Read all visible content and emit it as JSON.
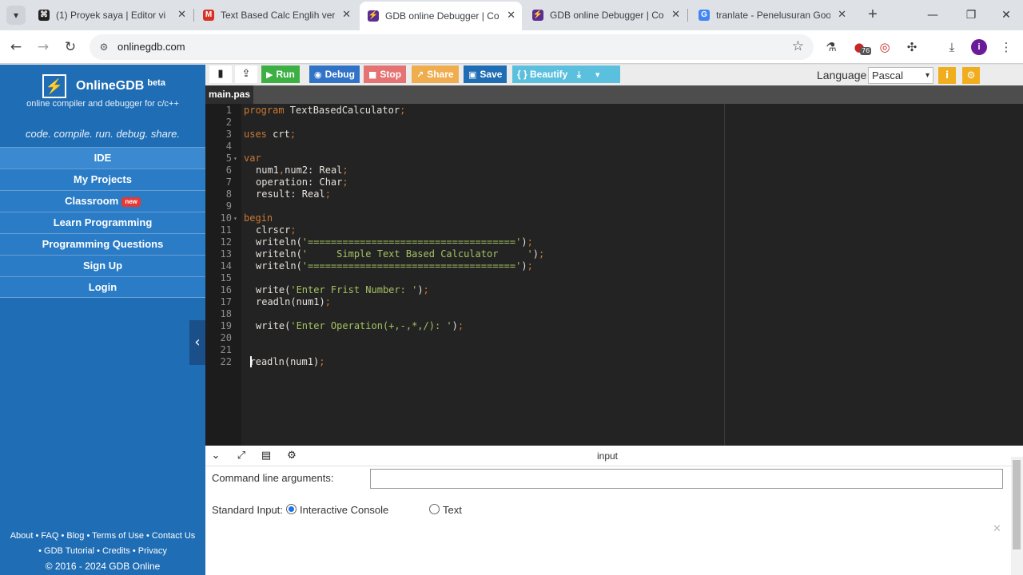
{
  "browser": {
    "tabs": [
      {
        "title": "(1) Proyek saya | Editor vi",
        "icon": "capcut-icon",
        "favicon_text": "⌘",
        "favicon_color": "#222222",
        "active": false
      },
      {
        "title": "Text Based Calc Englih versio",
        "icon": "gmail-icon",
        "favicon_text": "M",
        "favicon_color": "#d93025",
        "active": false
      },
      {
        "title": "GDB online Debugger | Com",
        "icon": "onlinegdb-icon",
        "favicon_text": "⚡",
        "favicon_color": "#5c2d91",
        "active": true
      },
      {
        "title": "GDB online Debugger | Com",
        "icon": "onlinegdb-icon",
        "favicon_text": "⚡",
        "favicon_color": "#5c2d91",
        "active": false
      },
      {
        "title": "tranlate - Penelusuran Goog",
        "icon": "google-icon",
        "favicon_text": "G",
        "favicon_color": "#4285f4",
        "active": false
      }
    ],
    "url": "onlinegdb.com",
    "extension_badge": "76",
    "profile_initial": "i"
  },
  "sidebar": {
    "brand": "OnlineGDB",
    "brand_sup": "beta",
    "tagline": "online compiler and debugger for c/c++",
    "slogan": "code. compile. run. debug. share.",
    "menu": [
      {
        "label": "IDE",
        "badge": ""
      },
      {
        "label": "My Projects",
        "badge": ""
      },
      {
        "label": "Classroom",
        "badge": "new"
      },
      {
        "label": "Learn Programming",
        "badge": ""
      },
      {
        "label": "Programming Questions",
        "badge": ""
      },
      {
        "label": "Sign Up",
        "badge": ""
      },
      {
        "label": "Login",
        "badge": ""
      }
    ],
    "footer_line1": "About • FAQ • Blog • Terms of Use • Contact Us",
    "footer_line2": "• GDB Tutorial • Credits • Privacy",
    "footer_copy": "© 2016 - 2024 GDB Online"
  },
  "toolbar": {
    "run": "Run",
    "debug": "Debug",
    "stop": "Stop",
    "share": "Share",
    "save": "Save",
    "beautify": "{ } Beautify",
    "language_label": "Language",
    "language_value": "Pascal",
    "colors": {
      "run": "#3cb043",
      "debug": "#3173c6",
      "stop": "#e57373",
      "share": "#f0ad4e",
      "save": "#1f6db4",
      "beautify": "#5bc0de",
      "download": "#5bc0de"
    }
  },
  "editor": {
    "file_tab": "main.pas",
    "lines": [
      {
        "n": "1",
        "fold": "",
        "indent": 0,
        "parts": [
          [
            "kw",
            "program"
          ],
          [
            "pn",
            " TextBasedCalculator"
          ],
          [
            "kw",
            ";"
          ]
        ]
      },
      {
        "n": "2",
        "fold": "",
        "indent": 0,
        "parts": []
      },
      {
        "n": "3",
        "fold": "",
        "indent": 0,
        "parts": [
          [
            "kw",
            "uses"
          ],
          [
            "pn",
            " crt"
          ],
          [
            "kw",
            ";"
          ]
        ]
      },
      {
        "n": "4",
        "fold": "",
        "indent": 0,
        "parts": []
      },
      {
        "n": "5",
        "fold": "▾",
        "indent": 0,
        "parts": [
          [
            "kw",
            "var"
          ]
        ]
      },
      {
        "n": "6",
        "fold": "",
        "indent": 2,
        "parts": [
          [
            "pn",
            "num1"
          ],
          [
            "kw",
            ","
          ],
          [
            "pn",
            "num2: Real"
          ],
          [
            "kw",
            ";"
          ]
        ]
      },
      {
        "n": "7",
        "fold": "",
        "indent": 2,
        "parts": [
          [
            "pn",
            "operation: Char"
          ],
          [
            "kw",
            ";"
          ]
        ]
      },
      {
        "n": "8",
        "fold": "",
        "indent": 2,
        "parts": [
          [
            "pn",
            "result: Real"
          ],
          [
            "kw",
            ";"
          ]
        ]
      },
      {
        "n": "9",
        "fold": "",
        "indent": 0,
        "parts": []
      },
      {
        "n": "10",
        "fold": "▾",
        "indent": 0,
        "parts": [
          [
            "kw",
            "begin"
          ]
        ]
      },
      {
        "n": "11",
        "fold": "",
        "indent": 2,
        "parts": [
          [
            "pn",
            "clrscr"
          ],
          [
            "kw",
            ";"
          ]
        ]
      },
      {
        "n": "12",
        "fold": "",
        "indent": 2,
        "parts": [
          [
            "pn",
            "writeln("
          ],
          [
            "str",
            "'===================================='"
          ],
          [
            "pn",
            ")"
          ],
          [
            "kw",
            ";"
          ]
        ]
      },
      {
        "n": "13",
        "fold": "",
        "indent": 2,
        "parts": [
          [
            "pn",
            "writeln("
          ],
          [
            "str",
            "'     Simple Text Based Calculator     '"
          ],
          [
            "pn",
            ")"
          ],
          [
            "kw",
            ";"
          ]
        ]
      },
      {
        "n": "14",
        "fold": "",
        "indent": 2,
        "parts": [
          [
            "pn",
            "writeln("
          ],
          [
            "str",
            "'===================================='"
          ],
          [
            "pn",
            ")"
          ],
          [
            "kw",
            ";"
          ]
        ]
      },
      {
        "n": "15",
        "fold": "",
        "indent": 0,
        "parts": []
      },
      {
        "n": "16",
        "fold": "",
        "indent": 2,
        "parts": [
          [
            "pn",
            "write("
          ],
          [
            "str",
            "'Enter Frist Number: '"
          ],
          [
            "pn",
            ")"
          ],
          [
            "kw",
            ";"
          ]
        ]
      },
      {
        "n": "17",
        "fold": "",
        "indent": 2,
        "parts": [
          [
            "pn",
            "readln(num1)"
          ],
          [
            "kw",
            ";"
          ]
        ]
      },
      {
        "n": "18",
        "fold": "",
        "indent": 0,
        "parts": []
      },
      {
        "n": "19",
        "fold": "",
        "indent": 2,
        "parts": [
          [
            "pn",
            "write("
          ],
          [
            "str",
            "'Enter Operation(+,-,*,/): '"
          ],
          [
            "pn",
            ")"
          ],
          [
            "kw",
            ";"
          ]
        ]
      },
      {
        "n": "20",
        "fold": "",
        "indent": 0,
        "parts": []
      },
      {
        "n": "21",
        "fold": "",
        "indent": 0,
        "parts": []
      },
      {
        "n": "22",
        "fold": "",
        "indent": 1,
        "parts": [
          [
            "pn",
            "readln(num1)"
          ],
          [
            "kw",
            ";"
          ]
        ]
      }
    ],
    "colors": {
      "background": "#232323",
      "keyword": "#cc7833",
      "string": "#a5c261",
      "text": "#e6e1dc"
    }
  },
  "bottom": {
    "title": "input",
    "cmd_label": "Command line arguments:",
    "cmd_value": "",
    "stdin_label": "Standard Input:",
    "opt_console": "Interactive Console",
    "opt_text": "Text",
    "selected": "Interactive Console"
  }
}
